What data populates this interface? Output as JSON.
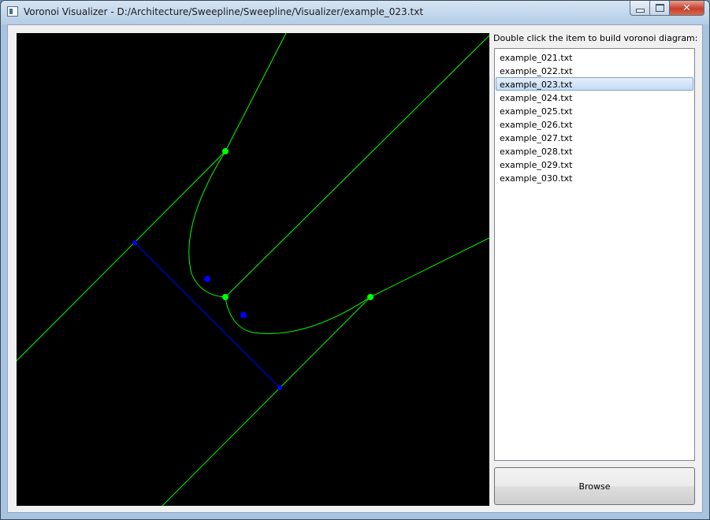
{
  "window": {
    "title": "Voronoi Visualizer - D:/Architecture/Sweepline/Sweepline/Visualizer/example_023.txt"
  },
  "panel": {
    "hint": "Double click the item to build voronoi diagram:",
    "files": [
      {
        "label": "example_021.txt",
        "selected": false
      },
      {
        "label": "example_022.txt",
        "selected": false
      },
      {
        "label": "example_023.txt",
        "selected": true
      },
      {
        "label": "example_024.txt",
        "selected": false
      },
      {
        "label": "example_025.txt",
        "selected": false
      },
      {
        "label": "example_026.txt",
        "selected": false
      },
      {
        "label": "example_027.txt",
        "selected": false
      },
      {
        "label": "example_028.txt",
        "selected": false
      },
      {
        "label": "example_029.txt",
        "selected": false
      },
      {
        "label": "example_030.txt",
        "selected": false
      }
    ],
    "browse_label": "Browse"
  },
  "colors": {
    "canvas_bg": "#000000",
    "voronoi_edge": "#00ff00",
    "voronoi_vertex": "#00ff00",
    "input_site": "#0000ff",
    "input_segment": "#0000ff"
  },
  "icons": [
    "app-icon",
    "minimize-icon",
    "maximize-icon",
    "close-icon"
  ]
}
